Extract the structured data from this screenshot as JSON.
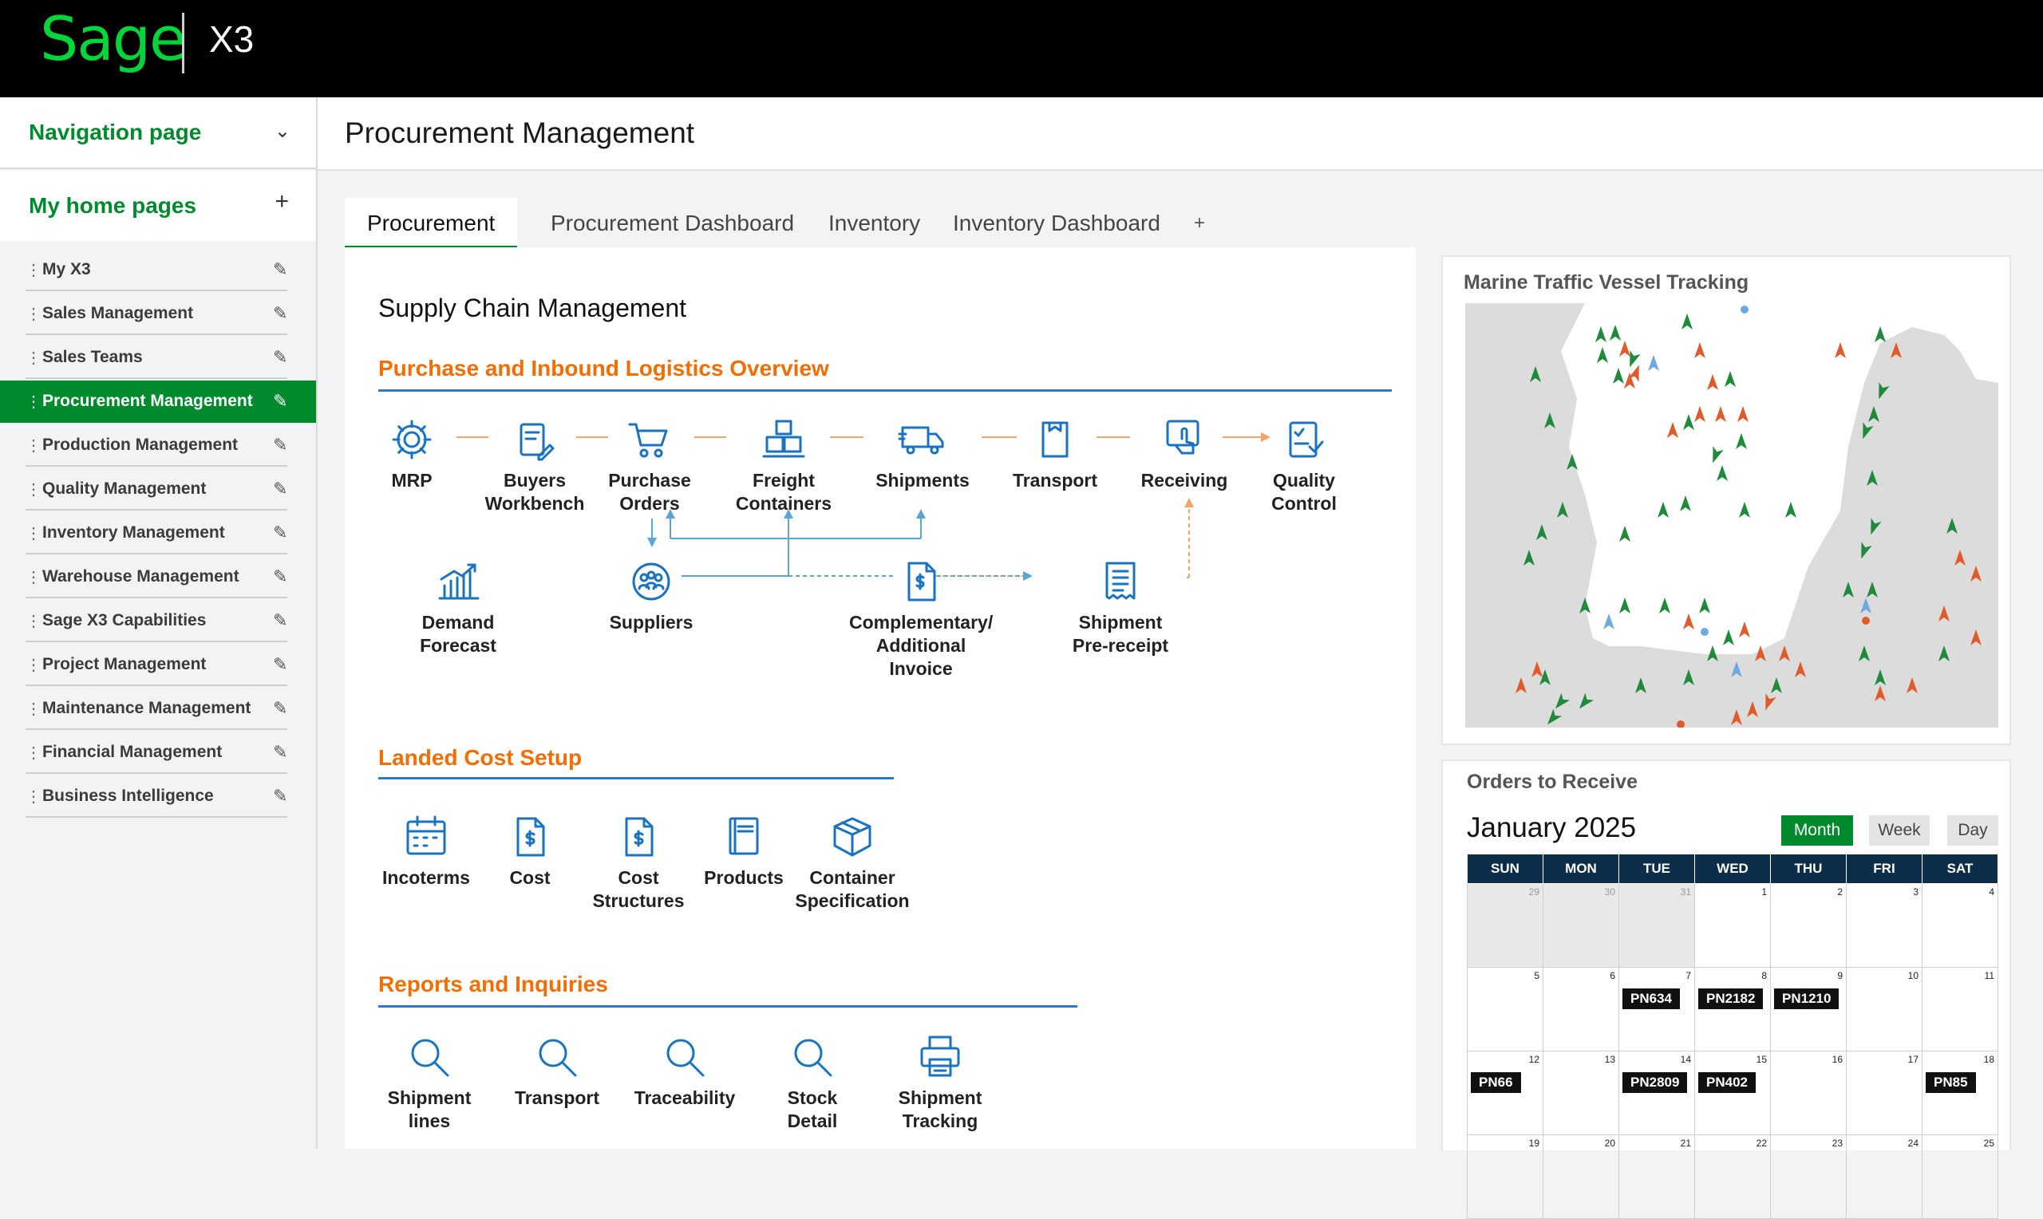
{
  "app": {
    "brand": "Sage",
    "product": "X3"
  },
  "sidebar": {
    "nav_title": "Navigation page",
    "home_title": "My home pages",
    "items": [
      {
        "label": "My X3"
      },
      {
        "label": "Sales Management"
      },
      {
        "label": "Sales Teams"
      },
      {
        "label": "Procurement Management",
        "active": true
      },
      {
        "label": "Production Management"
      },
      {
        "label": "Quality Management"
      },
      {
        "label": "Inventory Management"
      },
      {
        "label": "Warehouse Management"
      },
      {
        "label": "Sage X3 Capabilities"
      },
      {
        "label": "Project Management"
      },
      {
        "label": "Maintenance Management"
      },
      {
        "label": "Financial Management"
      },
      {
        "label": "Business Intelligence"
      }
    ]
  },
  "page": {
    "title": "Procurement Management"
  },
  "tabs": [
    "Procurement",
    "Procurement Dashboard",
    "Inventory",
    "Inventory Dashboard"
  ],
  "main": {
    "title": "Supply Chain Management",
    "section1": {
      "title": "Purchase and Inbound Logistics Overview",
      "row1": [
        "MRP",
        "Buyers\nWorkbench",
        "Purchase\nOrders",
        "Freight\nContainers",
        "Shipments",
        "Transport",
        "Receiving",
        "Quality\nControl"
      ],
      "row2": [
        "Demand\nForecast",
        "Suppliers",
        "Complementary/\nAdditional Invoice",
        "Shipment\nPre-receipt"
      ]
    },
    "section2": {
      "title": "Landed Cost Setup",
      "items": [
        "Incoterms",
        "Cost",
        "Cost\nStructures",
        "Products",
        "Container\nSpecification"
      ]
    },
    "section3": {
      "title": "Reports and Inquiries",
      "items": [
        "Shipment\nlines",
        "Transport",
        "Traceability",
        "Stock\nDetail",
        "Shipment\nTracking"
      ]
    }
  },
  "map_widget": {
    "title": "Marine Traffic Vessel Tracking"
  },
  "calendar": {
    "title": "Orders to Receive",
    "month": "January 2025",
    "views": [
      "Month",
      "Week",
      "Day"
    ],
    "active_view": "Month",
    "weekdays": [
      "SUN",
      "MON",
      "TUE",
      "WED",
      "THU",
      "FRI",
      "SAT"
    ],
    "weeks": [
      [
        {
          "d": "29",
          "out": true
        },
        {
          "d": "30",
          "out": true
        },
        {
          "d": "31",
          "out": true
        },
        {
          "d": "1"
        },
        {
          "d": "2"
        },
        {
          "d": "3"
        },
        {
          "d": "4"
        }
      ],
      [
        {
          "d": "5"
        },
        {
          "d": "6"
        },
        {
          "d": "7",
          "e": "PN634"
        },
        {
          "d": "8",
          "e": "PN2182"
        },
        {
          "d": "9",
          "e": "PN1210"
        },
        {
          "d": "10"
        },
        {
          "d": "11"
        }
      ],
      [
        {
          "d": "12",
          "e": "PN66"
        },
        {
          "d": "13"
        },
        {
          "d": "14",
          "e": "PN2809"
        },
        {
          "d": "15",
          "e": "PN402"
        },
        {
          "d": "16"
        },
        {
          "d": "17"
        },
        {
          "d": "18",
          "e": "PN85"
        }
      ],
      [
        {
          "d": "19"
        },
        {
          "d": "20"
        },
        {
          "d": "21"
        },
        {
          "d": "22"
        },
        {
          "d": "23"
        },
        {
          "d": "24"
        },
        {
          "d": "25"
        }
      ]
    ]
  },
  "colors": {
    "brand_green": "#008a2e",
    "logo_green": "#00d639",
    "section_orange": "#f36d00",
    "icon_blue": "#1a73c0",
    "calendar_header": "#0c2e4a"
  }
}
